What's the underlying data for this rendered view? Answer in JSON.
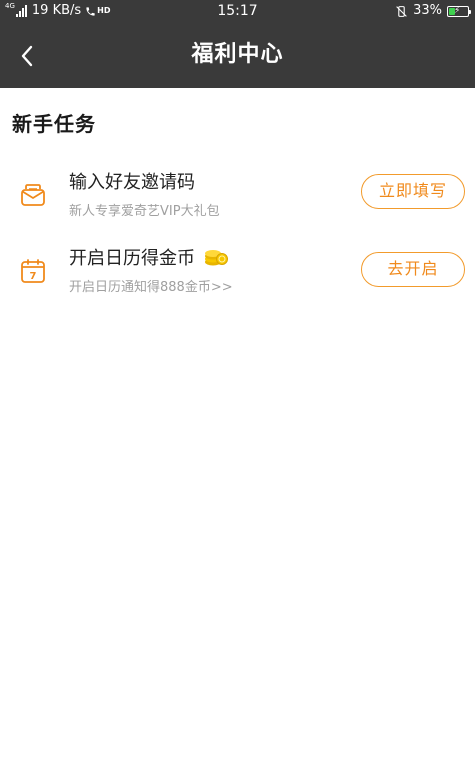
{
  "status_bar": {
    "network_tag": "4G",
    "net_speed": "19 KB/s",
    "hd_label": "HD",
    "time": "15:17",
    "battery_percent": "33%",
    "battery_level": 0.33,
    "battery_color": "#3fd14f"
  },
  "header": {
    "title": "福利中心",
    "back_icon": "chevron-left-icon",
    "background": "#3a3a3a"
  },
  "section": {
    "title": "新手任务"
  },
  "tasks": [
    {
      "icon": "envelope-icon",
      "title": "输入好友邀请码",
      "description": "新人专享爱奇艺VIP大礼包",
      "button_label": "立即填写"
    },
    {
      "icon": "calendar-icon",
      "calendar_day": "7",
      "title": "开启日历得金币",
      "title_badge_icon": "gold-coins-icon",
      "description": "开启日历通知得888金币>>",
      "button_label": "去开启"
    }
  ],
  "colors": {
    "accent": "#f08a1c",
    "button_border": "#f29b2c",
    "secondary_text": "#a0a0a0"
  }
}
